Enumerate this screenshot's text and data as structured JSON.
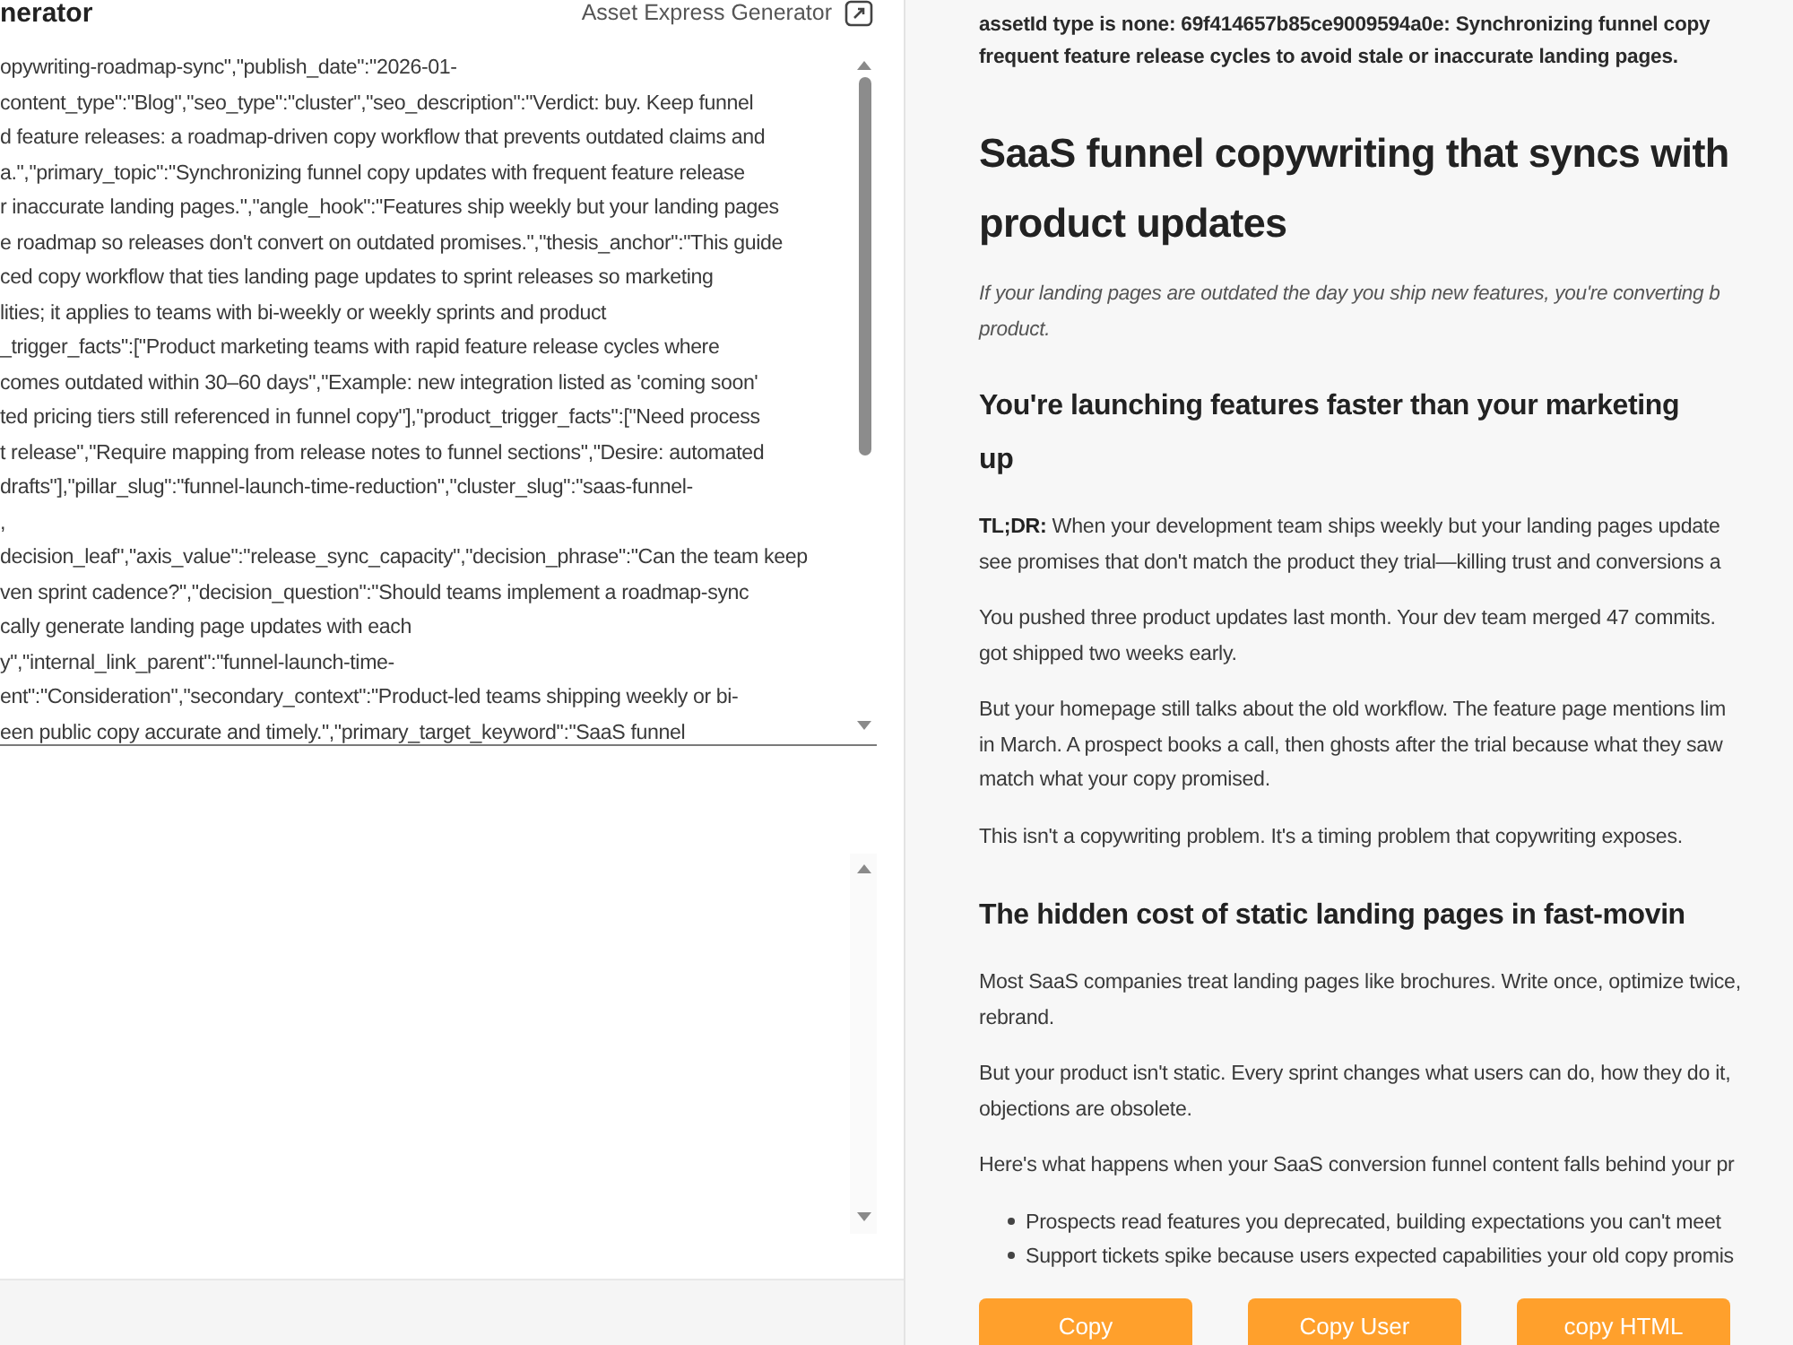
{
  "header": {
    "title": "nerator",
    "app_name": "Asset Express Generator"
  },
  "input_field": {
    "lines": [
      "opywriting-roadmap-sync\",\"publish_date\":\"2026-01-",
      "content_type\":\"Blog\",\"seo_type\":\"cluster\",\"seo_description\":\"Verdict: buy. Keep funnel",
      "d feature releases: a roadmap-driven copy workflow that prevents outdated claims and",
      "a.\",\"primary_topic\":\"Synchronizing funnel copy updates with frequent feature release",
      "r inaccurate landing pages.\",\"angle_hook\":\"Features ship weekly but your landing pages",
      "e roadmap so releases don't convert on outdated promises.\",\"thesis_anchor\":\"This guide",
      "ced copy workflow that ties landing page updates to sprint releases so marketing",
      "lities; it applies to teams with bi-weekly or weekly sprints and product",
      "_trigger_facts\":[\"Product marketing teams with rapid feature release cycles where",
      "comes outdated within 30–60 days\",\"Example: new integration listed as 'coming soon'",
      "ted pricing tiers still referenced in funnel copy\"],\"product_trigger_facts\":[\"Need process",
      "t release\",\"Require mapping from release notes to funnel sections\",\"Desire: automated",
      "drafts\"],\"pillar_slug\":\"funnel-launch-time-reduction\",\"cluster_slug\":\"saas-funnel-",
      ",",
      "decision_leaf\",\"axis_value\":\"release_sync_capacity\",\"decision_phrase\":\"Can the team keep",
      "ven sprint cadence?\",\"decision_question\":\"Should teams implement a roadmap-sync",
      "cally generate landing page updates with each",
      "y\",\"internal_link_parent\":\"funnel-launch-time-",
      "ent\":\"Consideration\",\"secondary_context\":\"Product-led teams shipping weekly or bi-",
      "een public copy accurate and timely.\",\"primary_target_keyword\":\"SaaS funnel"
    ]
  },
  "article": {
    "blocks": [
      {
        "kind": "note",
        "lines": [
          "assetId type is none: 69f414657b85ce9009594a0e: Synchronizing funnel copy",
          "frequent feature release cycles to avoid stale or inaccurate landing pages."
        ]
      },
      {
        "kind": "title",
        "lines": [
          "SaaS funnel copywriting that syncs with",
          "product updates"
        ]
      },
      {
        "kind": "lead",
        "lines": [
          "If your landing pages are outdated the day you ship new features, you're converting b",
          "product."
        ]
      },
      {
        "kind": "heading",
        "lines": [
          "You're launching features faster than your marketing",
          "up"
        ]
      },
      {
        "kind": "paragraph",
        "lines": [
          "**TL;DR:** When your development team ships weekly but your landing pages update",
          "see promises that don't match the product they trial—killing trust and conversions a"
        ]
      },
      {
        "kind": "paragraph",
        "lines": [
          "You pushed three product updates last month. Your dev team merged 47 commits.",
          "got shipped two weeks early."
        ]
      },
      {
        "kind": "paragraph",
        "lines": [
          "But your homepage still talks about the old workflow. The feature page mentions lim",
          "in March. A prospect books a call, then ghosts after the trial because what they saw",
          "match what your copy promised."
        ]
      },
      {
        "kind": "paragraph",
        "lines": [
          "This isn't a copywriting problem. It's a timing problem that copywriting exposes."
        ]
      },
      {
        "kind": "heading",
        "lines": [
          "The hidden cost of static landing pages in fast-movin"
        ]
      },
      {
        "kind": "paragraph",
        "lines": [
          "Most SaaS companies treat landing pages like brochures. Write once, optimize twice,",
          "rebrand."
        ]
      },
      {
        "kind": "paragraph",
        "lines": [
          "But your product isn't static. Every sprint changes what users can do, how they do it,",
          "objections are obsolete."
        ]
      },
      {
        "kind": "paragraph",
        "lines": [
          "Here's what happens when your SaaS conversion funnel content falls behind your pr"
        ]
      },
      {
        "kind": "bullets",
        "items": [
          "Prospects read features you deprecated, building expectations you can't meet",
          "Support tickets spike because users expected capabilities your old copy promis"
        ]
      }
    ]
  },
  "buttons": [
    {
      "label": "Copy"
    },
    {
      "label": "Copy User"
    },
    {
      "label": "copy HTML"
    }
  ]
}
